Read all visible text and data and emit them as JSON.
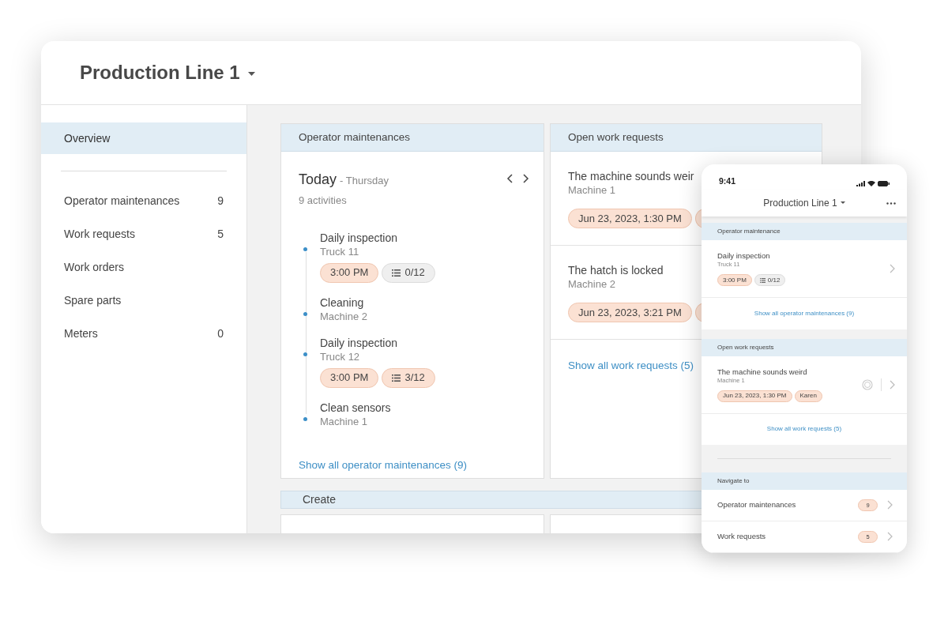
{
  "header": {
    "title": "Production Line 1"
  },
  "sidebar": {
    "groups": [
      {
        "items": [
          {
            "label": "Overview",
            "selected": true
          }
        ]
      },
      {
        "items": [
          {
            "label": "Operator maintenances",
            "count": "9",
            "selected": false
          },
          {
            "label": "Work requests",
            "count": "5",
            "selected": false
          },
          {
            "label": "Work orders",
            "selected": false
          },
          {
            "label": "Spare parts",
            "selected": false
          },
          {
            "label": "Meters",
            "count": "0",
            "selected": false
          }
        ]
      }
    ]
  },
  "operator_panel": {
    "title": "Operator maintenances",
    "day": "Today",
    "weekday": "- Thursday",
    "activity_count": "9 activities",
    "activities": [
      {
        "title": "Daily inspection",
        "subtitle": "Truck 11",
        "chips": [
          {
            "kind": "time",
            "text": "3:00 PM",
            "color": "#fbe1d3"
          },
          {
            "kind": "checklist",
            "text": "0/12",
            "color": "#efefef"
          }
        ]
      },
      {
        "title": "Cleaning",
        "subtitle": "Machine 2"
      },
      {
        "title": "Daily inspection",
        "subtitle": "Truck 12",
        "chips": [
          {
            "kind": "time",
            "text": "3:00 PM",
            "color": "#fbe1d3"
          },
          {
            "kind": "checklist",
            "text": "3/12",
            "color": "#fbe1d3"
          }
        ]
      },
      {
        "title": "Clean sensors",
        "subtitle": "Machine 1"
      }
    ],
    "link": "Show all operator maintenances (9)"
  },
  "requests_panel": {
    "title": "Open work requests",
    "requests": [
      {
        "title": "The machine sounds weir",
        "subtitle": "Machine 1",
        "chips": [
          {
            "kind": "date",
            "text": "Jun 23, 2023, 1:30 PM"
          },
          {
            "kind": "stub"
          }
        ]
      },
      {
        "title": "The hatch is locked",
        "subtitle": "Machine 2",
        "chips": [
          {
            "kind": "date",
            "text": "Jun 23, 2023, 3:21 PM"
          },
          {
            "kind": "stub"
          }
        ]
      }
    ],
    "link": "Show all work requests (5)"
  },
  "create": {
    "title": "Create"
  },
  "phone": {
    "time": "9:41",
    "title": "Production Line 1",
    "operator_section": {
      "title": "Operator maintenance",
      "items": [
        {
          "title": "Daily inspection",
          "subtitle": "Truck 11",
          "chips": [
            {
              "kind": "time",
              "text": "3:00 PM",
              "color": "#fbe1d3"
            },
            {
              "kind": "checklist",
              "text": "0/12",
              "color": "#efefef"
            }
          ]
        }
      ],
      "link": "Show all operator maintenances (9)"
    },
    "requests_section": {
      "title": "Open work requests",
      "items": [
        {
          "title": "The machine sounds weird",
          "subtitle": "Machine 1",
          "chips": [
            {
              "text": "Jun 23, 2023, 1:30 PM"
            },
            {
              "text": "Karen"
            }
          ]
        }
      ],
      "link": "Show all work requests (5)"
    },
    "navigate": {
      "title": "Navigate to",
      "items": [
        {
          "label": "Operator maintenances",
          "count": "9"
        },
        {
          "label": "Work requests",
          "count": "5"
        }
      ]
    }
  }
}
